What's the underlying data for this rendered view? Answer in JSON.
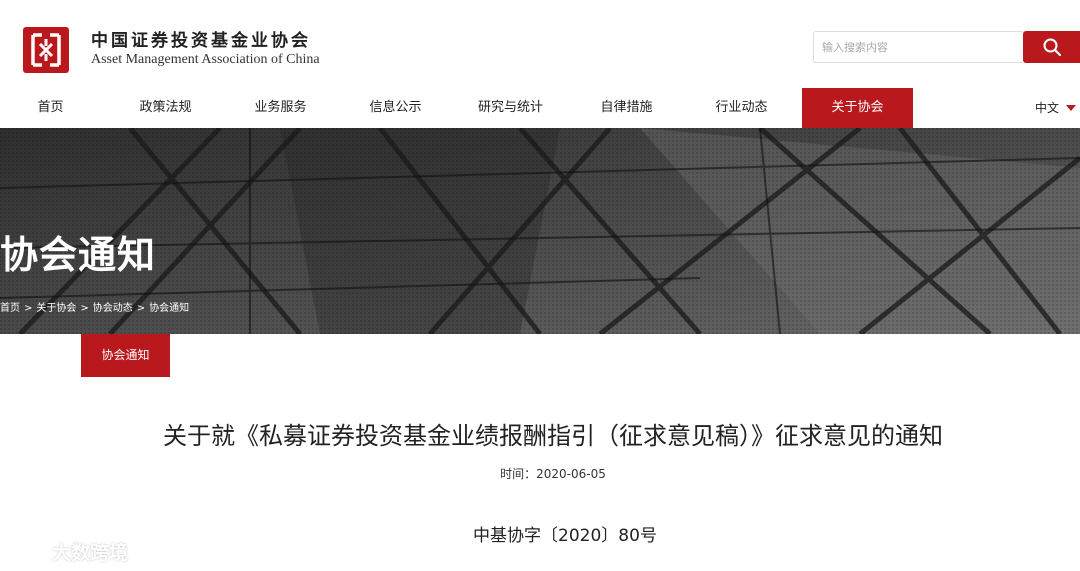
{
  "brand": {
    "name_cn": "中国证券投资基金业协会",
    "name_en": "Asset Management Association of China"
  },
  "search": {
    "placeholder": "输入搜索内容"
  },
  "nav": {
    "items": [
      "首页",
      "政策法规",
      "业务服务",
      "信息公示",
      "研究与统计",
      "自律措施",
      "行业动态",
      "关于协会"
    ],
    "active": "关于协会",
    "language": "中文"
  },
  "banner": {
    "title": "协会通知",
    "breadcrumb": [
      "首页",
      "关于协会",
      "协会动态",
      "协会通知"
    ],
    "separator": ">"
  },
  "subnav": {
    "tab": "协会通知"
  },
  "article": {
    "title": "关于就《私募证券投资基金业绩报酬指引（征求意见稿）》征求意见的通知",
    "time": "时间：2020-06-05",
    "doc_number": "中基协字〔2020〕80号"
  },
  "watermark": {
    "text": "大数跨境"
  },
  "colors": {
    "accent": "#b9191c",
    "banner": "#3c3c3c"
  }
}
